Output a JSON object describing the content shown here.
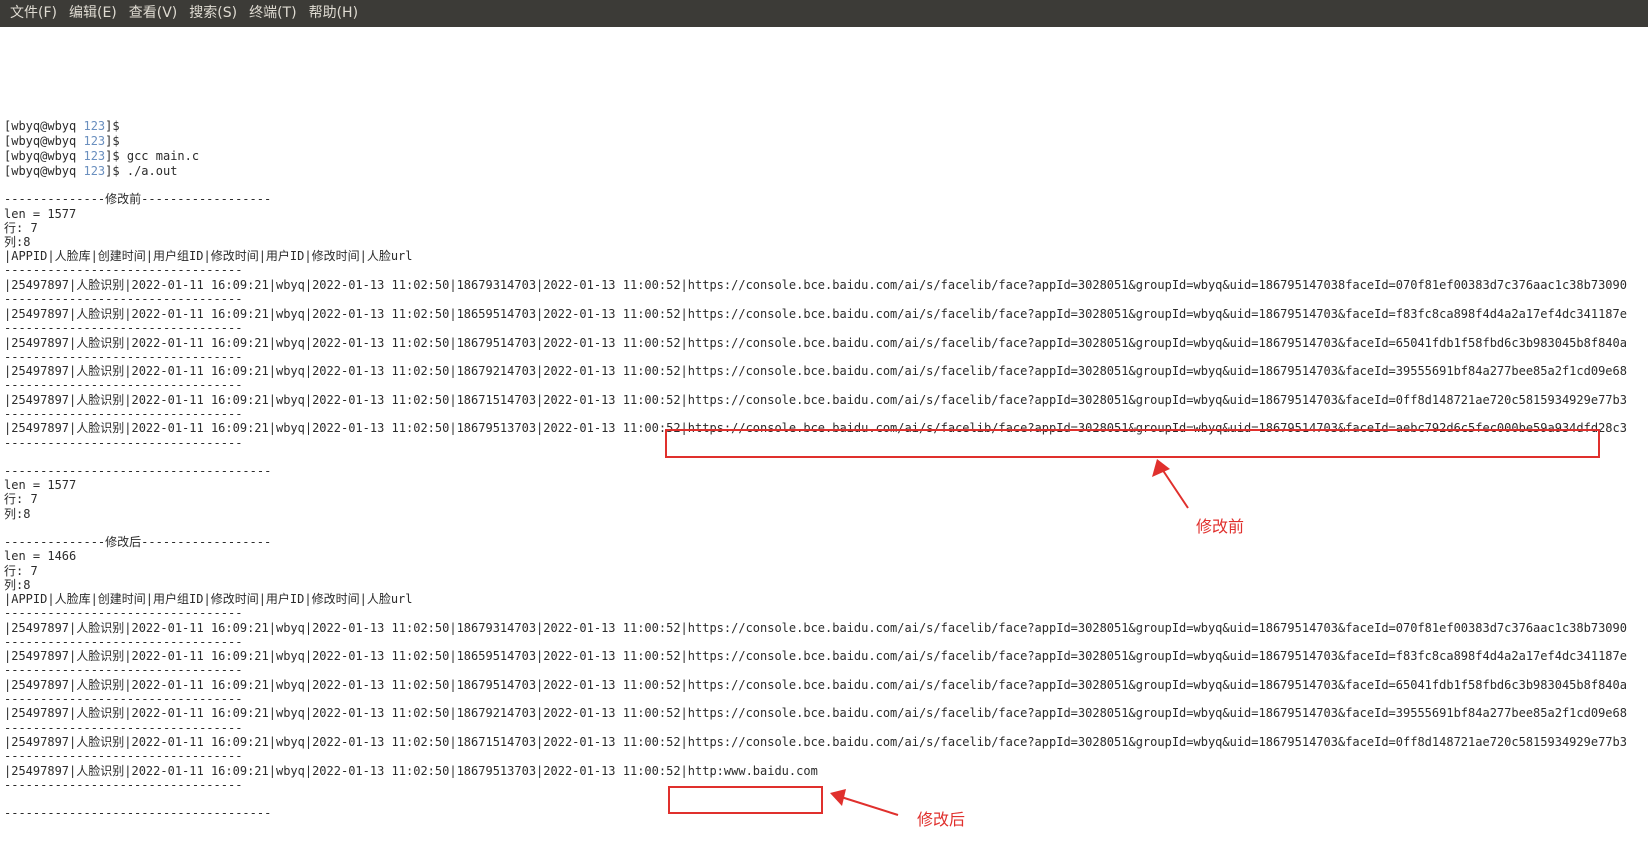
{
  "menu": {
    "file": "文件(F)",
    "edit": "编辑(E)",
    "view": "查看(V)",
    "search": "搜索(S)",
    "terminal": "终端(T)",
    "help": "帮助(H)"
  },
  "prompt": {
    "user": "[wbyq@wbyq ",
    "dir": "123",
    "end": "]$"
  },
  "commands": [
    "",
    "",
    " gcc main.c",
    " ./a.out"
  ],
  "output": {
    "before_header": "--------------修改前------------------",
    "before_len": "len = 1577",
    "before_rows": "行: 7",
    "before_cols": "列:8",
    "table_header": "|APPID|人脸库|创建时间|用户组ID|修改时间|用户ID|修改时间|人脸url",
    "sep_short": "---------------------------------",
    "sep_long": "-------------------------------------",
    "before_records": [
      "|25497897|人脸识别|2022-01-11 16:09:21|wbyq|2022-01-13 11:02:50|18679314703|2022-01-13 11:00:52|https://console.bce.baidu.com/ai/s/facelib/face?appId=3028051&groupId=wbyq&uid=186795147038faceId=070f81ef00383d7c376aac1c38b73090",
      "|25497897|人脸识别|2022-01-11 16:09:21|wbyq|2022-01-13 11:02:50|18659514703|2022-01-13 11:00:52|https://console.bce.baidu.com/ai/s/facelib/face?appId=3028051&groupId=wbyq&uid=18679514703&faceId=f83fc8ca898f4d4a2a17ef4dc341187e",
      "|25497897|人脸识别|2022-01-11 16:09:21|wbyq|2022-01-13 11:02:50|18679514703|2022-01-13 11:00:52|https://console.bce.baidu.com/ai/s/facelib/face?appId=3028051&groupId=wbyq&uid=18679514703&faceId=65041fdb1f58fbd6c3b983045b8f840a",
      "|25497897|人脸识别|2022-01-11 16:09:21|wbyq|2022-01-13 11:02:50|18679214703|2022-01-13 11:00:52|https://console.bce.baidu.com/ai/s/facelib/face?appId=3028051&groupId=wbyq&uid=18679514703&faceId=39555691bf84a277bee85a2f1cd09e68",
      "|25497897|人脸识别|2022-01-11 16:09:21|wbyq|2022-01-13 11:02:50|18671514703|2022-01-13 11:00:52|https://console.bce.baidu.com/ai/s/facelib/face?appId=3028051&groupId=wbyq&uid=18679514703&faceId=0ff8d148721ae720c5815934929e77b3",
      "|25497897|人脸识别|2022-01-11 16:09:21|wbyq|2022-01-13 11:02:50|18679513703|2022-01-13 11:00:52|https://console.bce.baidu.com/ai/s/facelib/face?appId=3028051&groupId=wbyq&uid=18679514703&faceId=aebc792d6c5fec000be59a934dfd28c3"
    ],
    "mid_sep": "-------------------------------------",
    "mid_len": "len = 1577",
    "mid_rows": "行: 7",
    "mid_cols": "列:8",
    "after_header": "--------------修改后------------------",
    "after_len": "len = 1466",
    "after_rows": "行: 7",
    "after_cols": "列:8",
    "after_records": [
      "|25497897|人脸识别|2022-01-11 16:09:21|wbyq|2022-01-13 11:02:50|18679314703|2022-01-13 11:00:52|https://console.bce.baidu.com/ai/s/facelib/face?appId=3028051&groupId=wbyq&uid=18679514703&faceId=070f81ef00383d7c376aac1c38b73090",
      "|25497897|人脸识别|2022-01-11 16:09:21|wbyq|2022-01-13 11:02:50|18659514703|2022-01-13 11:00:52|https://console.bce.baidu.com/ai/s/facelib/face?appId=3028051&groupId=wbyq&uid=18679514703&faceId=f83fc8ca898f4d4a2a17ef4dc341187e",
      "|25497897|人脸识别|2022-01-11 16:09:21|wbyq|2022-01-13 11:02:50|18679514703|2022-01-13 11:00:52|https://console.bce.baidu.com/ai/s/facelib/face?appId=3028051&groupId=wbyq&uid=18679514703&faceId=65041fdb1f58fbd6c3b983045b8f840a",
      "|25497897|人脸识别|2022-01-11 16:09:21|wbyq|2022-01-13 11:02:50|18679214703|2022-01-13 11:00:52|https://console.bce.baidu.com/ai/s/facelib/face?appId=3028051&groupId=wbyq&uid=18679514703&faceId=39555691bf84a277bee85a2f1cd09e68",
      "|25497897|人脸识别|2022-01-11 16:09:21|wbyq|2022-01-13 11:02:50|18671514703|2022-01-13 11:00:52|https://console.bce.baidu.com/ai/s/facelib/face?appId=3028051&groupId=wbyq&uid=18679514703&faceId=0ff8d148721ae720c5815934929e77b3",
      "|25497897|人脸识别|2022-01-11 16:09:21|wbyq|2022-01-13 11:02:50|18679513703|2022-01-13 11:00:52|http:www.baidu.com"
    ],
    "final_sep": "-------------------------------------"
  },
  "annotations": {
    "before_label": "修改前",
    "after_label": "修改后",
    "color": "#e0302d"
  }
}
